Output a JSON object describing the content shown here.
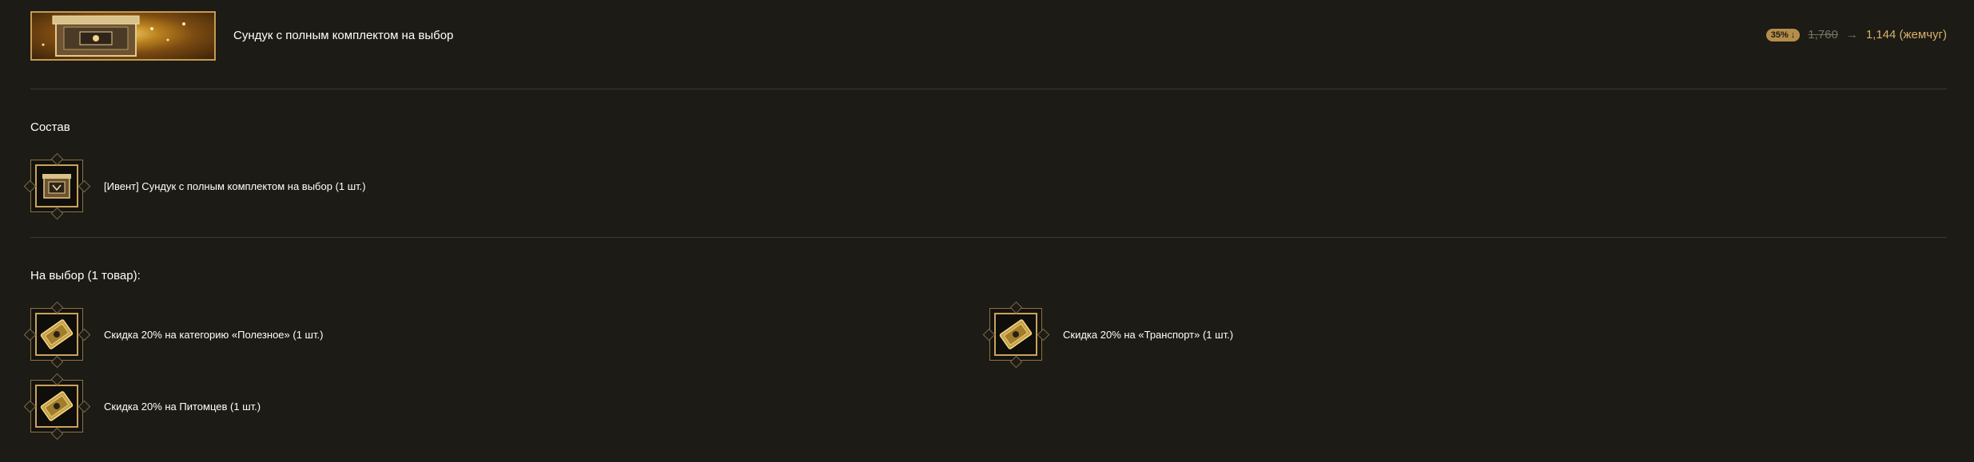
{
  "header": {
    "title": "Сундук с полным комплектом на выбор",
    "discount_badge": "35% ↓",
    "old_price": "1,760",
    "arrow": "→",
    "new_price": "1,144 (жемчуг)"
  },
  "composition": {
    "title": "Состав",
    "items": [
      {
        "label": "[Ивент] Сундук с полным комплектом на выбор (1 шт.)",
        "icon": "treasure-chest-icon"
      }
    ]
  },
  "choice": {
    "title": "На выбор (1 товар):",
    "items": [
      {
        "label": "Скидка 20% на категорию «Полезное» (1 шт.)",
        "icon": "coupon-icon"
      },
      {
        "label": "Скидка 20% на «Транспорт» (1 шт.)",
        "icon": "coupon-icon"
      },
      {
        "label": "Скидка 20% на Питомцев (1 шт.)",
        "icon": "coupon-icon"
      }
    ]
  },
  "colors": {
    "background": "#1c1b15",
    "gold_accent": "#d8b06a",
    "frame": "#caa25d",
    "divider": "#3b3a31"
  }
}
